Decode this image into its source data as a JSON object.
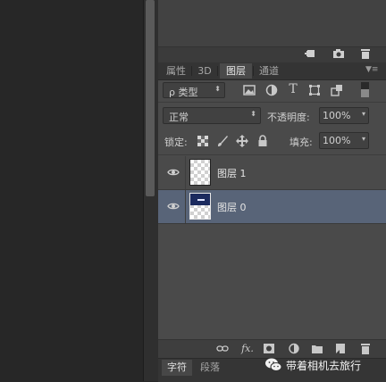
{
  "panel_top": {
    "footer_icons": [
      "new-comp-icon",
      "camera-icon",
      "trash-icon"
    ]
  },
  "tabs": [
    {
      "label": "属性",
      "active": false
    },
    {
      "label": "3D",
      "active": false
    },
    {
      "label": "图层",
      "active": true
    },
    {
      "label": "通道",
      "active": false
    }
  ],
  "filter": {
    "kind_label": "ρ 类型",
    "icons": [
      "image-filter-icon",
      "adjustment-filter-icon",
      "type-filter-icon",
      "shape-filter-icon",
      "smart-object-filter-icon"
    ]
  },
  "blend": {
    "mode": "正常",
    "opacity_label": "不透明度:",
    "opacity_value": "100%"
  },
  "lock": {
    "label": "锁定:",
    "fill_label": "填充:",
    "fill_value": "100%"
  },
  "layers": [
    {
      "name": "图层 1",
      "visible": true,
      "selected": false,
      "thumbnail": "transparent"
    },
    {
      "name": "图层 0",
      "visible": true,
      "selected": true,
      "thumbnail": "photo"
    }
  ],
  "footer_icons": [
    "link-layers-icon",
    "fx-icon",
    "add-mask-icon",
    "adjustment-layer-icon",
    "new-group-icon",
    "new-layer-icon",
    "delete-layer-icon"
  ],
  "footer_fx_label": "fx.",
  "bottom_tabs": [
    {
      "label": "字符",
      "active": true
    },
    {
      "label": "段落",
      "active": false
    }
  ],
  "watermark": {
    "text": "带着相机去旅行"
  },
  "colors": {
    "selected_layer": "#586478",
    "panel_bg": "#4a4a4a",
    "workspace": "#272727"
  }
}
